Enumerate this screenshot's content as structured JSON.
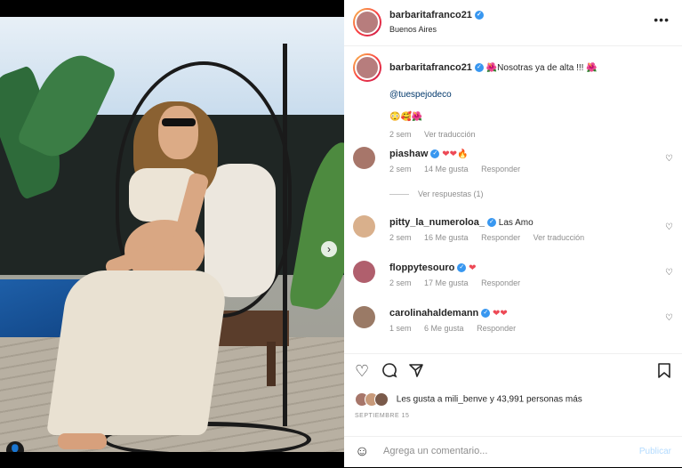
{
  "post": {
    "username": "barbaritafranco21",
    "location": "Buenos Aires",
    "more_icon": "more-dots-icon",
    "caption": {
      "text": "🌺Nosotras ya de alta !!! 🌺",
      "mention": "@tuespejodeco",
      "emojis": "😳🥰🌺",
      "time": "2 sem",
      "translate": "Ver traducción"
    },
    "comments": [
      {
        "username": "piashaw",
        "text": "❤❤🔥",
        "time": "2 sem",
        "likes": "14 Me gusta",
        "reply": "Responder",
        "avatar_color": "#a7766a"
      },
      {
        "username": "pitty_la_numeroloa_",
        "text": "Las Amo",
        "time": "2 sem",
        "likes": "16 Me gusta",
        "reply": "Responder",
        "translate": "Ver traducción",
        "avatar_color": "#d9b08c"
      },
      {
        "username": "floppytesouro",
        "text": "❤",
        "time": "2 sem",
        "likes": "17 Me gusta",
        "reply": "Responder",
        "avatar_color": "#b05f6d"
      },
      {
        "username": "carolinahaldemann",
        "text": "❤❤",
        "time": "1 sem",
        "likes": "6 Me gusta",
        "reply": "Responder",
        "avatar_color": "#9a7a66"
      }
    ],
    "view_replies": "Ver respuestas (1)",
    "likes_text": "Les gusta a mili_benve y 43,991 personas más",
    "date": "SEPTIEMBRE 15",
    "add_comment_placeholder": "Agrega un comentario...",
    "publish_label": "Publicar"
  },
  "icons": {
    "like": "heart-icon",
    "comment": "comment-icon",
    "share": "share-icon",
    "save": "bookmark-icon"
  },
  "colors": {
    "link": "#00376b",
    "verified": "#3897f0",
    "heart_red": "#ed4956",
    "publish_disabled": "#b3dbff"
  }
}
